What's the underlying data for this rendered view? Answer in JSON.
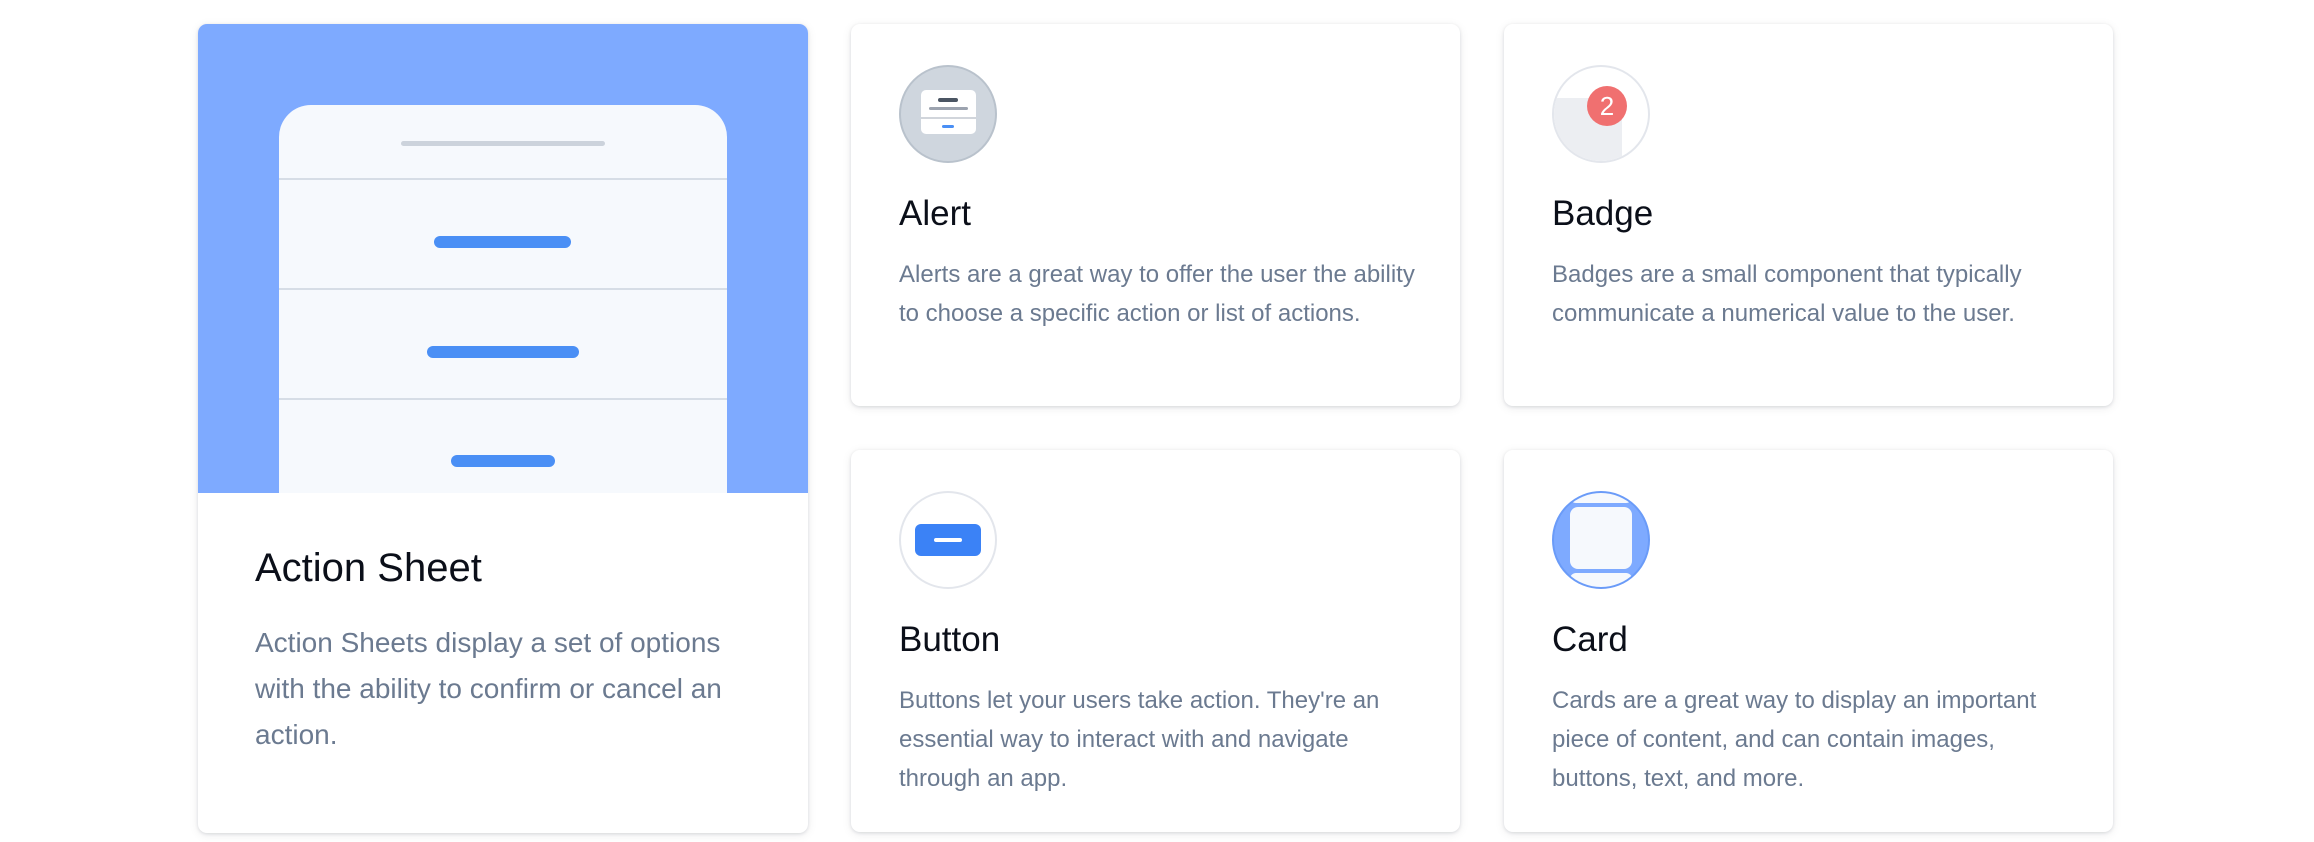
{
  "components": {
    "action_sheet": {
      "title": "Action Sheet",
      "description": "Action Sheets display a set of options with the ability to confirm or cancel an action."
    },
    "alert": {
      "title": "Alert",
      "description": "Alerts are a great way to offer the user the ability to choose a specific action or list of actions.",
      "icon": "alert-icon"
    },
    "badge": {
      "title": "Badge",
      "description": "Badges are a small component that typically communicate a numerical value to the user.",
      "icon": "badge-icon",
      "badge_count": "2"
    },
    "button": {
      "title": "Button",
      "description": "Buttons let your users take action. They're an essential way to interact with and navigate through an app.",
      "icon": "button-icon"
    },
    "card": {
      "title": "Card",
      "description": "Cards are a great way to display an important piece of content, and can contain images, buttons, text, and more.",
      "icon": "card-icon"
    }
  },
  "colors": {
    "accent_blue": "#4a8ff5",
    "hero_blue": "#7eaaff",
    "badge_red": "#f07070",
    "text_muted": "#6b7a90"
  }
}
